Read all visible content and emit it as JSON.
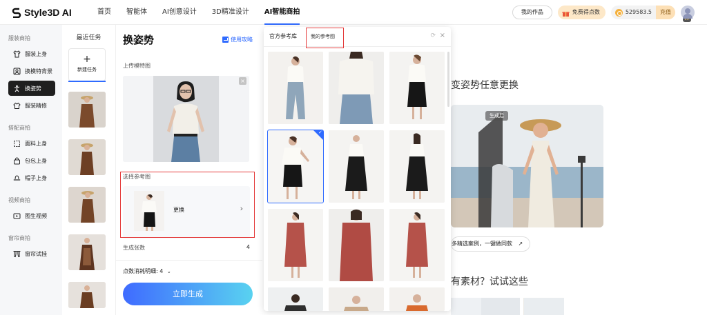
{
  "brand": {
    "name": "Style3D AI"
  },
  "nav": {
    "items": [
      "首页",
      "智能体",
      "AI创意设计",
      "3D精准设计",
      "AI智能商拍"
    ],
    "active_index": 4
  },
  "header": {
    "my_works": "我的作品",
    "free_points": "免费得点数",
    "points": "529583.5",
    "recharge": "充值",
    "vip": "VIP"
  },
  "sidebar": {
    "groups": [
      {
        "title": "服装商拍",
        "items": [
          {
            "label": "服装上身",
            "icon": "garment-icon"
          },
          {
            "label": "换模特背景",
            "icon": "model-swap-icon"
          },
          {
            "label": "换姿势",
            "icon": "pose-icon",
            "active": true
          },
          {
            "label": "服装精修",
            "icon": "retouch-icon"
          }
        ]
      },
      {
        "title": "搭配商拍",
        "items": [
          {
            "label": "面料上身",
            "icon": "fabric-icon"
          },
          {
            "label": "包包上身",
            "icon": "bag-icon"
          },
          {
            "label": "帽子上身",
            "icon": "hat-icon"
          }
        ]
      },
      {
        "title": "视频商拍",
        "items": [
          {
            "label": "图生视频",
            "icon": "video-icon"
          }
        ]
      },
      {
        "title": "窗帘商拍",
        "items": [
          {
            "label": "窗帘试挂",
            "icon": "curtain-icon"
          }
        ]
      }
    ]
  },
  "tasks": {
    "title": "最近任务",
    "new_task_label": "新建任务",
    "new_task_icon": "plus-icon"
  },
  "pose_panel": {
    "title": "换姿势",
    "guide_link": "使用攻略",
    "upload_label": "上传模特图",
    "select_label": "选择参考图",
    "replace_label": "更换",
    "count_label": "生成张数",
    "count_value": "4",
    "cost_label": "点数消耗明细: 4",
    "generate_button": "立即生成"
  },
  "ref_panel": {
    "tabs": [
      "官方参考库",
      "我的参考图"
    ],
    "active_tab_index": 1,
    "selected_index": 3
  },
  "background": {
    "heading": "变姿势任意更换",
    "tag": "生成后",
    "cases_button": "多精选案例，一键做同款",
    "heading2": "有素材？试试这些"
  },
  "colors": {
    "accent": "#2f6bff",
    "highlight": "#e43a3a"
  }
}
